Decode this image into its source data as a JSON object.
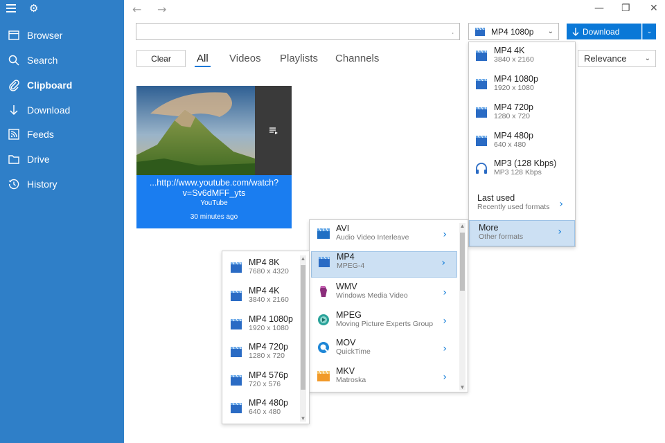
{
  "sidebar": {
    "items": [
      {
        "label": "Browser",
        "icon": "browser-icon"
      },
      {
        "label": "Search",
        "icon": "search-icon"
      },
      {
        "label": "Clipboard",
        "icon": "paperclip-icon"
      },
      {
        "label": "Download",
        "icon": "download-arrow-icon"
      },
      {
        "label": "Feeds",
        "icon": "rss-icon"
      },
      {
        "label": "Drive",
        "icon": "folder-icon"
      },
      {
        "label": "History",
        "icon": "history-icon"
      }
    ],
    "active": "Clipboard"
  },
  "toolbar": {
    "url_value": "",
    "format_selected": "MP4 1080p",
    "download_label": "Download"
  },
  "tabs": {
    "clear_label": "Clear",
    "items": [
      "All",
      "Videos",
      "Playlists",
      "Channels"
    ],
    "active": "All",
    "sort_selected": "Relevance"
  },
  "card": {
    "url_line1": "...http://www.youtube.com/watch?",
    "url_line2": "v=Sv6dMFF_yts",
    "source": "YouTube",
    "time": "30 minutes ago"
  },
  "format_menu": {
    "items": [
      {
        "title": "MP4 4K",
        "sub": "3840 x 2160"
      },
      {
        "title": "MP4 1080p",
        "sub": "1920 x 1080"
      },
      {
        "title": "MP4 720p",
        "sub": "1280 x 720"
      },
      {
        "title": "MP4 480p",
        "sub": "640 x 480"
      },
      {
        "title": "MP3 (128 Kbps)",
        "sub": "MP3 128 Kbps"
      }
    ],
    "last_used": {
      "title": "Last used",
      "sub": "Recently used formats"
    },
    "more": {
      "title": "More",
      "sub": "Other formats"
    }
  },
  "container_menu": {
    "items": [
      {
        "title": "AVI",
        "sub": "Audio Video Interleave"
      },
      {
        "title": "MP4",
        "sub": "MPEG-4"
      },
      {
        "title": "WMV",
        "sub": "Windows Media Video"
      },
      {
        "title": "MPEG",
        "sub": "Moving Picture Experts Group"
      },
      {
        "title": "MOV",
        "sub": "QuickTime"
      },
      {
        "title": "MKV",
        "sub": "Matroska"
      }
    ]
  },
  "mp4_menu": {
    "items": [
      {
        "title": "MP4 8K",
        "sub": "7680 x 4320"
      },
      {
        "title": "MP4 4K",
        "sub": "3840 x 2160"
      },
      {
        "title": "MP4 1080p",
        "sub": "1920 x 1080"
      },
      {
        "title": "MP4 720p",
        "sub": "1280 x 720"
      },
      {
        "title": "MP4 576p",
        "sub": "720 x 576"
      },
      {
        "title": "MP4 480p",
        "sub": "640 x 480"
      }
    ]
  },
  "colors": {
    "sidebar": "#2f7fc8",
    "accent": "#0a78d7",
    "card": "#1a7df0"
  }
}
